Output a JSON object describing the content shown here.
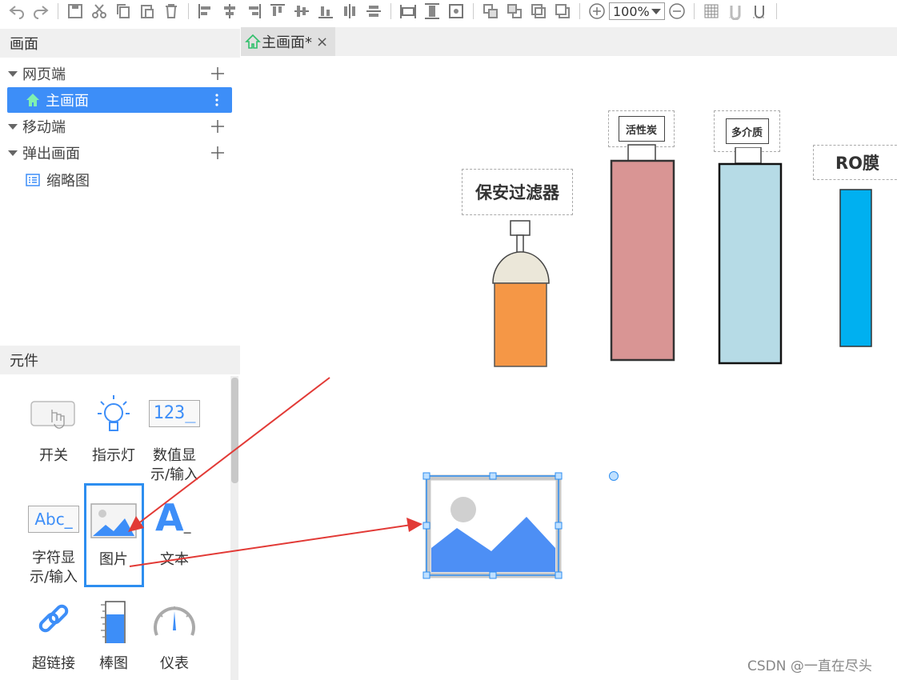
{
  "toolbar": {
    "zoom": "100%"
  },
  "screen_panel": {
    "title": "画面",
    "groups": [
      {
        "label": "网页端"
      },
      {
        "label": "主画面"
      },
      {
        "label": "移动端"
      },
      {
        "label": "弹出画面"
      },
      {
        "label": "缩略图"
      }
    ]
  },
  "components_panel": {
    "title": "元件",
    "items": [
      {
        "label": "开关"
      },
      {
        "label": "指示灯"
      },
      {
        "label": "数值显\n示/输入"
      },
      {
        "label": "字符显\n示/输入"
      },
      {
        "label": "图片"
      },
      {
        "label": "文本"
      },
      {
        "label": "超链接"
      },
      {
        "label": "棒图"
      },
      {
        "label": "仪表"
      }
    ],
    "icon_texts": {
      "numeric": "123_",
      "string": "Abc_",
      "text": "A"
    }
  },
  "tab": {
    "label": "主画面*",
    "close": "×"
  },
  "canvas": {
    "labels": {
      "filter": "保安过滤器",
      "carbon": "活性炭",
      "media": "多介质",
      "ro": "RO膜"
    },
    "colors": {
      "filter_body": "#f59746",
      "carbon_body": "#d99594",
      "media_body": "#b6dbe6",
      "ro_body": "#00b0f0",
      "selection": "#2d8ef0",
      "arrow": "#e23a36"
    }
  },
  "watermark": "CSDN @一直在尽头"
}
